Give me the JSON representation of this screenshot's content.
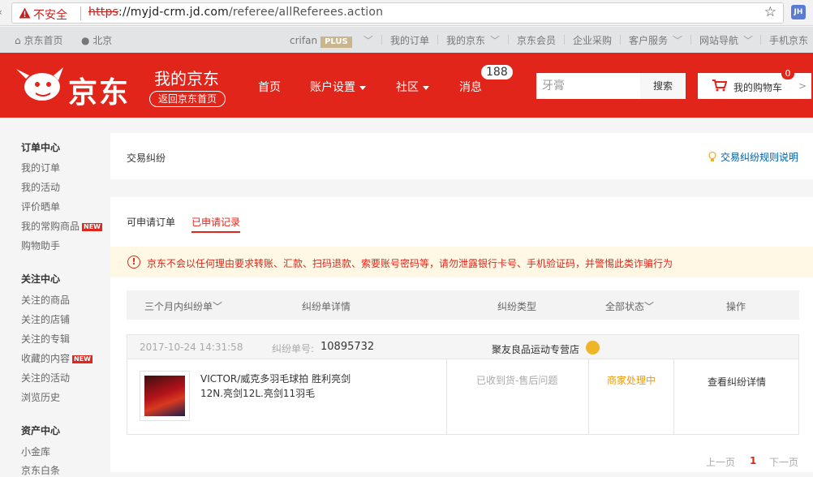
{
  "browser": {
    "insecure_label": "不安全",
    "url_scheme": "https",
    "url_host": "://myjd-crm.jd.com",
    "url_path": "/referee/allReferees.action",
    "extension_label": "JH"
  },
  "topbar": {
    "home": "京东首页",
    "location": "北京",
    "username": "crifan",
    "plus": "PLUS",
    "links": [
      "我的订单",
      "我的京东",
      "京东会员",
      "企业采购",
      "客户服务",
      "网站导航",
      "手机京东"
    ]
  },
  "header": {
    "logo_text": "京东",
    "my_jd": "我的京东",
    "back_home": "返回京东首页",
    "nav": [
      "首页",
      "账户设置",
      "社区",
      "消息"
    ],
    "message_count": "188",
    "search_value": "牙膏",
    "search_button": "搜索",
    "cart_label": "我的购物车",
    "cart_count": "0",
    "cart_arrow": ">"
  },
  "sidebar": {
    "sections": [
      {
        "title": "订单中心",
        "items": [
          "我的订单",
          "我的活动",
          "评价晒单",
          "我的常购商品",
          "购物助手"
        ]
      },
      {
        "title": "关注中心",
        "items": [
          "关注的商品",
          "关注的店铺",
          "关注的专辑",
          "收藏的内容",
          "关注的活动",
          "浏览历史"
        ]
      },
      {
        "title": "资产中心",
        "items": [
          "小金库",
          "京东白条"
        ]
      }
    ],
    "new_tag": "NEW"
  },
  "page": {
    "title": "交易纠纷",
    "rules_link": "交易纠纷规则说明",
    "tabs": [
      "可申请订单",
      "已申请记录"
    ],
    "notice": "京东不会以任何理由要求转账、汇款、扫码退款、索要账号密码等，请勿泄露银行卡号、手机验证码，并警惕此类诈骗行为",
    "table_headers": [
      "三个月内纠纷单",
      "纠纷单详情",
      "纠纷类型",
      "全部状态",
      "操作"
    ]
  },
  "order": {
    "date": "2017-10-24 14:31:58",
    "number_label": "纠纷单号:",
    "number": "10895732",
    "shop": "聚友良品运动专营店",
    "product_name": "VICTOR/威克多羽毛球拍 胜利亮剑12N.亮剑12L.亮剑11羽毛",
    "type": "已收到货-售后问题",
    "status": "商家处理中",
    "action": "查看纠纷详情"
  },
  "pagination": {
    "prev": "上一页",
    "current": "1",
    "next": "下一页"
  },
  "colors": {
    "brand": "#e1251b",
    "pending": "#f39800",
    "link": "#005ea7"
  }
}
